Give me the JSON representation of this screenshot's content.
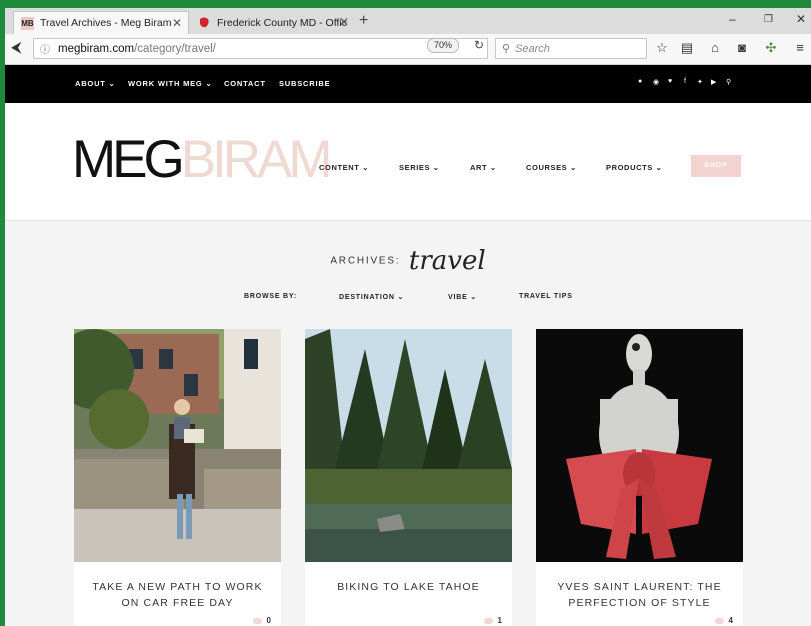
{
  "browser": {
    "tabs": [
      {
        "favicon": "MB",
        "title": "Travel Archives - Meg Biram",
        "active": true
      },
      {
        "favicon": "maryland-flag-icon",
        "title": "Frederick County MD - Offic",
        "active": false
      }
    ],
    "url_domain": "megbiram.com",
    "url_path": "/category/travel/",
    "zoom": "70%",
    "search_placeholder": "Search"
  },
  "site": {
    "topbar_links": [
      "ABOUT",
      "WORK WITH MEG",
      "CONTACT",
      "SUBSCRIBE"
    ],
    "social_icons": [
      "bloglovin-icon",
      "pinterest-icon",
      "heart-icon",
      "facebook-icon",
      "twitter-icon",
      "youtube-icon",
      "search-icon"
    ],
    "logo_part1": "MEG",
    "logo_part2": "BIRAM",
    "main_nav": [
      "CONTENT",
      "SERIES",
      "ART",
      "COURSES",
      "PRODUCTS"
    ],
    "shop_label": "SHOP"
  },
  "archive": {
    "label": "ARCHIVES:",
    "category": "travel",
    "browse_label": "BROWSE BY:",
    "filters": [
      "DESTINATION",
      "VIBE",
      "TRAVEL TIPS"
    ]
  },
  "posts": [
    {
      "title": "TAKE A NEW PATH TO WORK ON CAR FREE DAY",
      "comments": "0"
    },
    {
      "title": "BIKING TO LAKE TAHOE",
      "comments": "1"
    },
    {
      "title": "YVES SAINT LAURENT: THE PERFECTION OF STYLE",
      "comments": "4"
    }
  ],
  "colors": {
    "accent_pink": "#f2d3cf",
    "topbar": "#000000",
    "page_bg": "#f4f4f4",
    "outer_border": "#1f8a3c"
  }
}
